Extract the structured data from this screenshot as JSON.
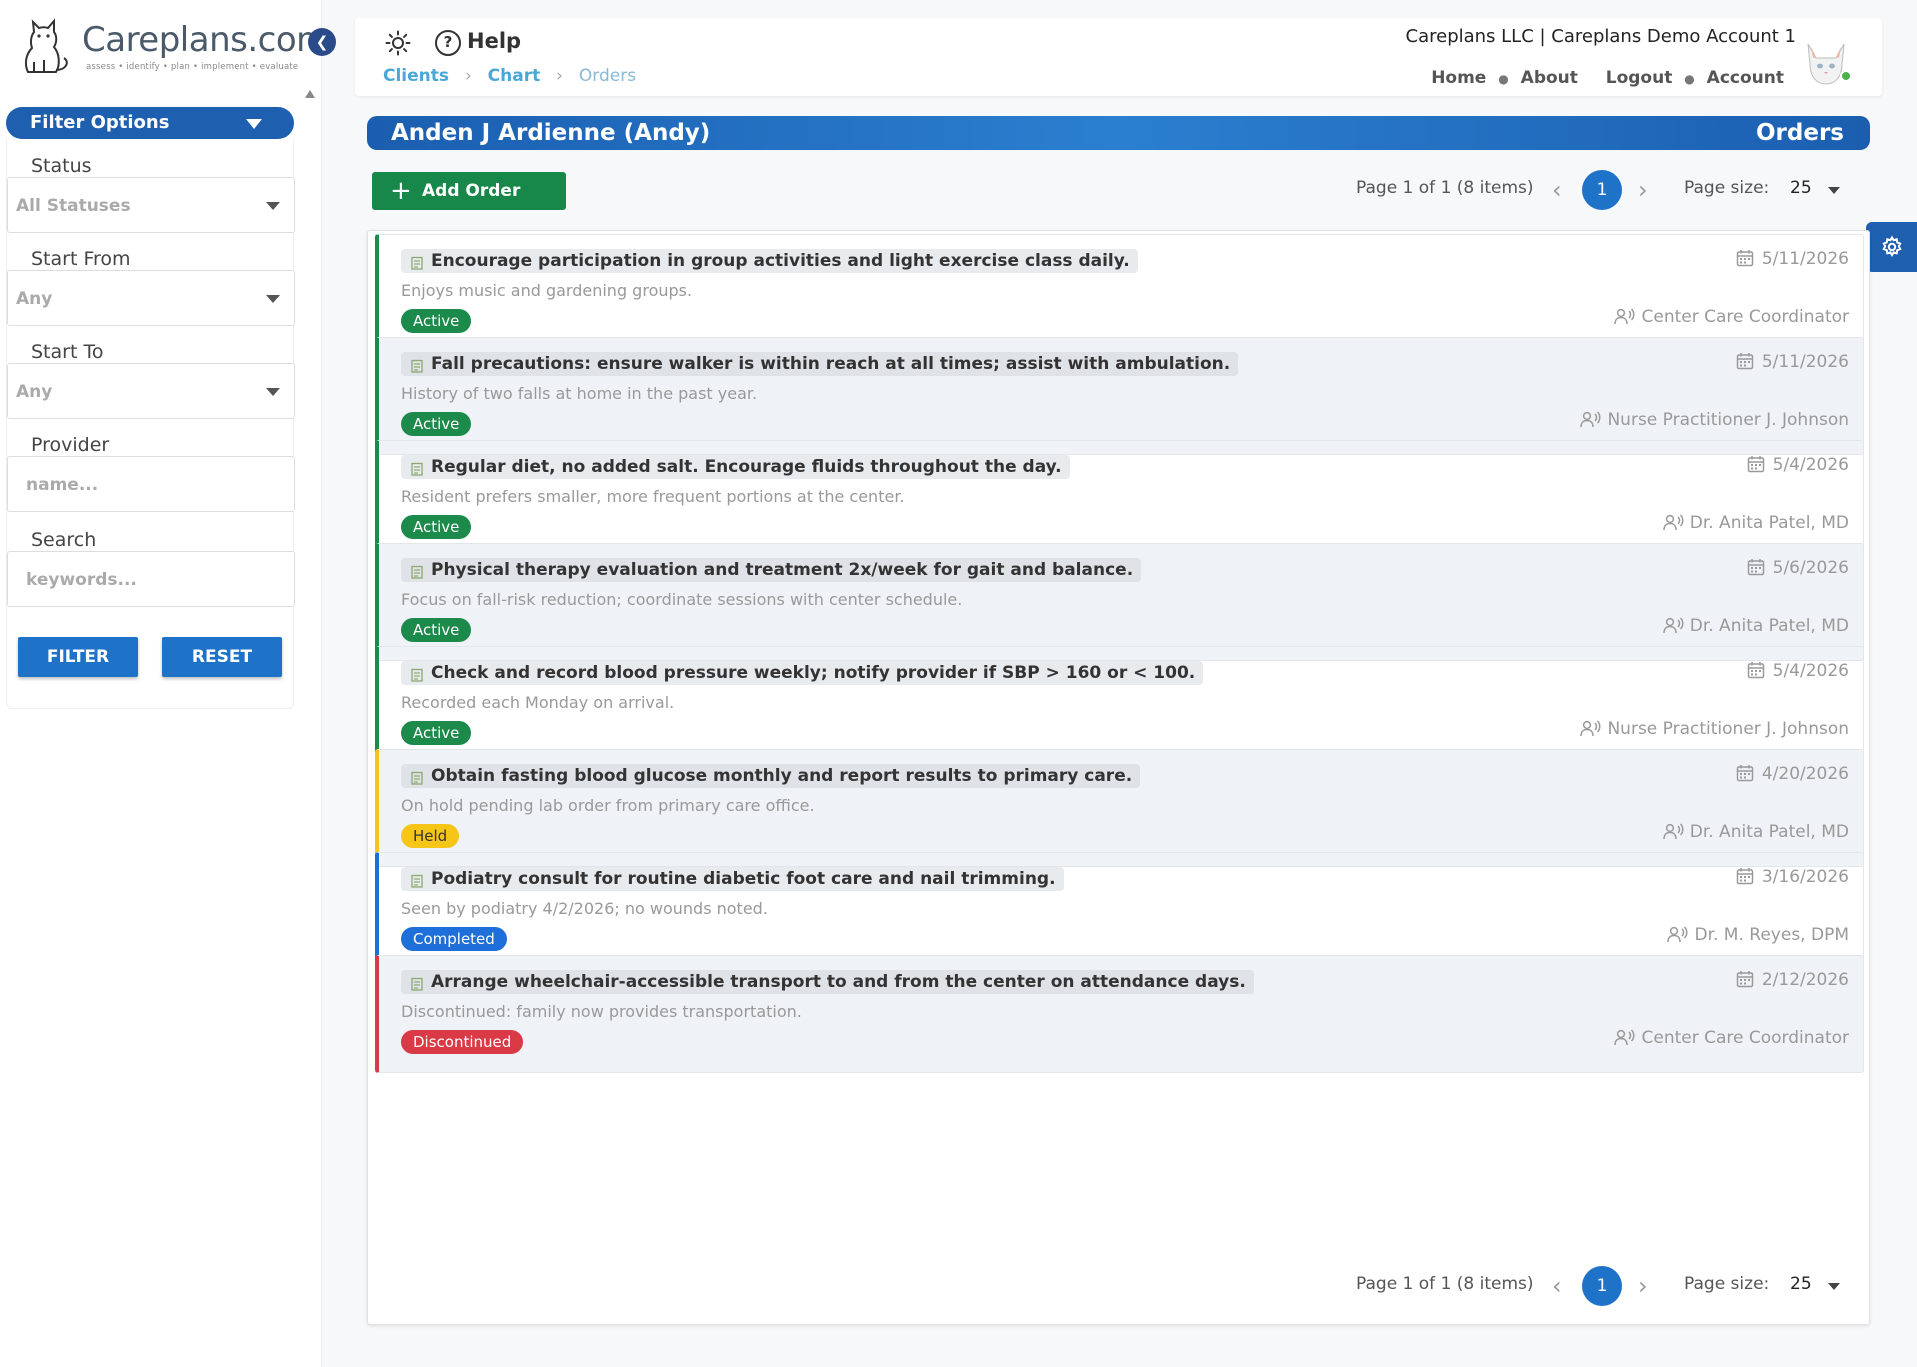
{
  "app": {
    "brand": "Careplans.com",
    "tagline": "assess • identify • plan • implement • evaluate"
  },
  "sidebar": {
    "filter_title": "Filter Options",
    "fields": [
      {
        "label": "Status",
        "value": "All Statuses"
      },
      {
        "label": "Start From",
        "value": "Any"
      },
      {
        "label": "Start To",
        "value": "Any"
      },
      {
        "label": "Provider",
        "placeholder": "name..."
      },
      {
        "label": "Search",
        "placeholder": "keywords..."
      }
    ],
    "filter_button": "FILTER",
    "reset_button": "RESET"
  },
  "topbar": {
    "help_label": "Help",
    "breadcrumbs": [
      "Clients",
      "Chart",
      "Orders"
    ],
    "account_name": "Careplans LLC | Careplans Demo Account 1",
    "links": [
      "Home",
      "About",
      "Logout",
      "Account"
    ]
  },
  "patient": {
    "name": "Anden J Ardienne (Andy)",
    "section": "Orders"
  },
  "toolbar": {
    "add_label": "Add Order"
  },
  "pagination": {
    "info": "Page 1 of 1 (8 items)",
    "current_page": "1",
    "page_size_label": "Page size:",
    "page_size": "25"
  },
  "status_colors": {
    "Active": "#1b8a4a",
    "Held": "#f5c518",
    "Completed": "#1e6fd9",
    "Discontinued": "#d93a45"
  },
  "orders": [
    {
      "title": "Encourage participation in group activities and light exercise class daily.",
      "note": "Enjoys music and gardening groups.",
      "status": "Active",
      "date": "5/11/2026",
      "provider": "Center Care Coordinator"
    },
    {
      "title": "Fall precautions: ensure walker is within reach at all times; assist with ambulation.",
      "note": "History of two falls at home in the past year.",
      "status": "Active",
      "date": "5/11/2026",
      "provider": "Nurse Practitioner J. Johnson"
    },
    {
      "title": "Regular diet, no added salt. Encourage fluids throughout the day.",
      "note": "Resident prefers smaller, more frequent portions at the center.",
      "status": "Active",
      "date": "5/4/2026",
      "provider": "Dr. Anita Patel, MD"
    },
    {
      "title": "Physical therapy evaluation and treatment 2x/week for gait and balance.",
      "note": "Focus on fall-risk reduction; coordinate sessions with center schedule.",
      "status": "Active",
      "date": "5/6/2026",
      "provider": "Dr. Anita Patel, MD"
    },
    {
      "title": "Check and record blood pressure weekly; notify provider if SBP > 160 or < 100.",
      "note": "Recorded each Monday on arrival.",
      "status": "Active",
      "date": "5/4/2026",
      "provider": "Nurse Practitioner J. Johnson"
    },
    {
      "title": "Obtain fasting blood glucose monthly and report results to primary care.",
      "note": "On hold pending lab order from primary care office.",
      "status": "Held",
      "date": "4/20/2026",
      "provider": "Dr. Anita Patel, MD"
    },
    {
      "title": "Podiatry consult for routine diabetic foot care and nail trimming.",
      "note": "Seen by podiatry 4/2/2026; no wounds noted.",
      "status": "Completed",
      "date": "3/16/2026",
      "provider": "Dr. M. Reyes, DPM"
    },
    {
      "title": "Arrange wheelchair-accessible transport to and from the center on attendance days.",
      "note": "Discontinued: family now provides transportation.",
      "status": "Discontinued",
      "date": "2/12/2026",
      "provider": "Center Care Coordinator"
    }
  ]
}
